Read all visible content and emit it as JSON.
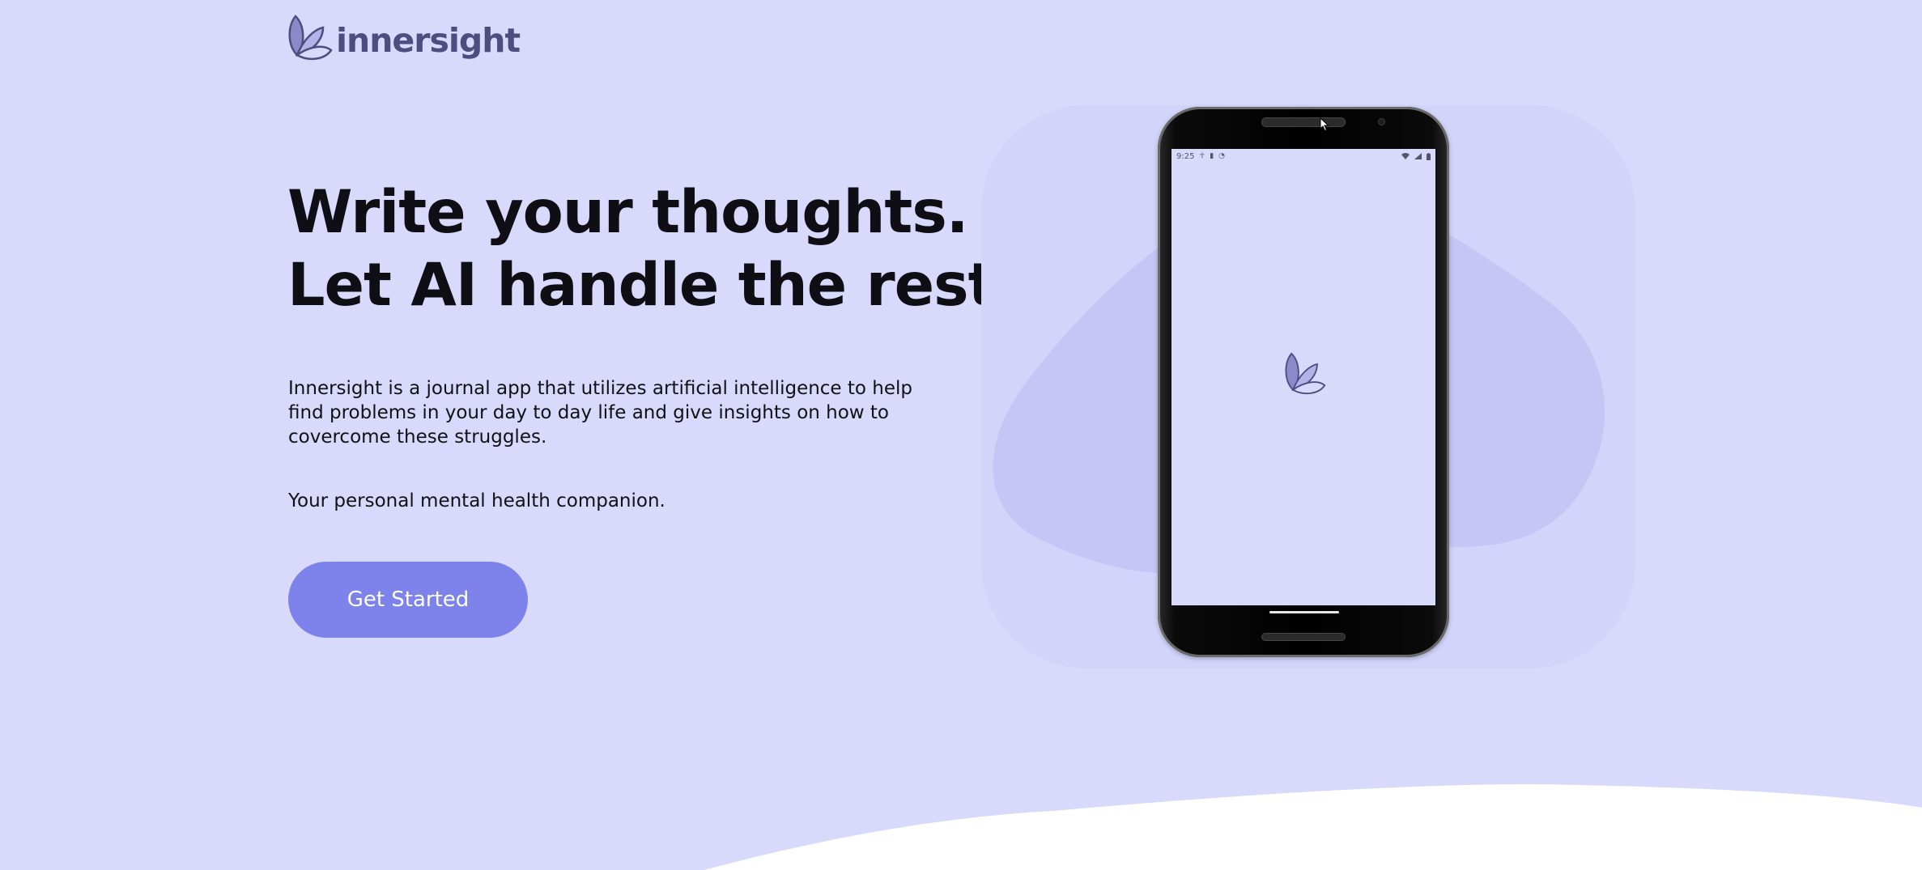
{
  "brand": {
    "name": "innersight",
    "logo_icon": "butterfly-leaves-icon",
    "color": "#4f4d80"
  },
  "hero": {
    "title_line1": "Write your thoughts.",
    "title_line2": "Let AI handle the rest.",
    "description": "Innersight is a journal app that utilizes artificial intelligence to help find problems in your day to day life and give insights on how to covercome these struggles.",
    "tagline": "Your personal mental health companion.",
    "cta_label": "Get Started"
  },
  "phone": {
    "status_time": "9:25",
    "status_left_icons": [
      "accessibility-icon",
      "sd-card-icon",
      "sync-icon"
    ],
    "status_right_icons": [
      "wifi-icon",
      "signal-icon",
      "battery-icon"
    ],
    "screen_logo": "butterfly-leaves-icon"
  },
  "colors": {
    "page_background": "#d8d9fb",
    "showcase_background": "#d3d4fa",
    "blob": "#c5c6f5",
    "cta_background": "#7e83ec",
    "cta_text": "#ffffff",
    "heading_text": "#0e0e14",
    "wave": "#ffffff"
  }
}
